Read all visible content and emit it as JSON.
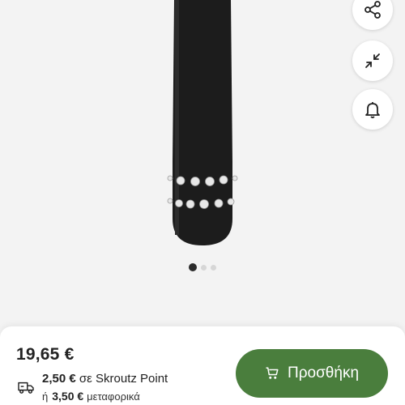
{
  "product": {
    "price": "19,65 €",
    "shipping": {
      "point_amount": "2,50 €",
      "point_text": "σε Skroutz Point",
      "or_word": "ή",
      "courier_amount": "3,50 €",
      "courier_text": "μεταφορικά"
    },
    "add_button_label": "Προσθήκη"
  },
  "gallery": {
    "total_images": 3,
    "active_index": 0
  },
  "icons": {
    "share": "share-icon",
    "collapse": "collapse-icon",
    "alert": "bell-icon",
    "truck": "truck-icon",
    "cart": "cart-icon"
  },
  "colors": {
    "accent": "#4a7e3d",
    "background": "#f3f3f3"
  }
}
